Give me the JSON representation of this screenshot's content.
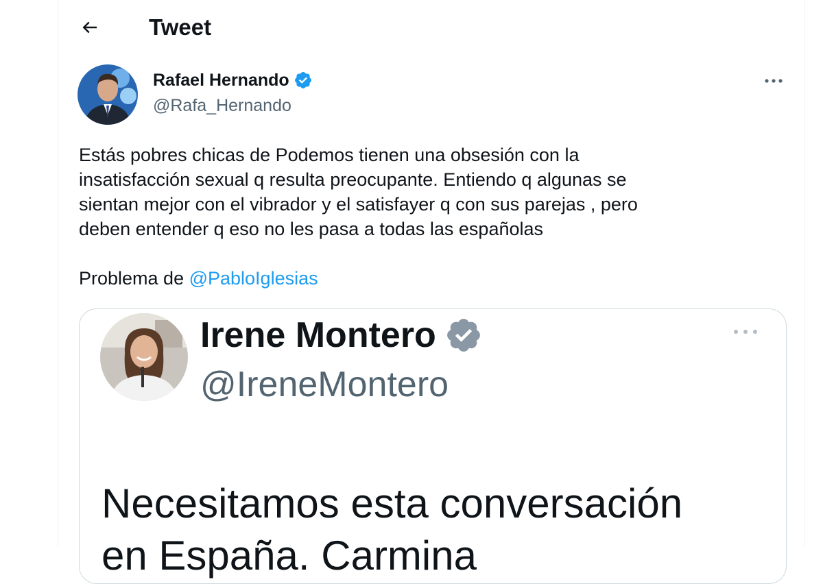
{
  "header": {
    "title": "Tweet",
    "back_icon": "arrow-left-icon"
  },
  "tweet": {
    "author": {
      "name": "Rafael Hernando",
      "handle": "@Rafa_Hernando",
      "verified": true
    },
    "text": {
      "line1": "Estás pobres chicas de Podemos tienen una obsesión con la",
      "line2": "insatisfacción sexual q resulta preocupante. Entiendo q algunas se",
      "line3": "sientan mejor con el vibrador y el satisfayer q con sus parejas , pero",
      "line4": "deben entender q eso no les pasa a todas las españolas",
      "line5_prefix": "Problema de ",
      "line5_mention": "@PabloIglesias"
    },
    "more_icon": "more-horizontal-icon"
  },
  "embedded_image": {
    "author": {
      "name": "Irene Montero",
      "handle": "@IreneMontero",
      "verified": true
    },
    "text": {
      "line1": "Necesitamos esta conversación",
      "line2": "en España. Carmina"
    }
  },
  "colors": {
    "accent": "#1d9bf0",
    "text": "#0f1419",
    "secondary": "#536471",
    "border": "#cfd9de"
  }
}
